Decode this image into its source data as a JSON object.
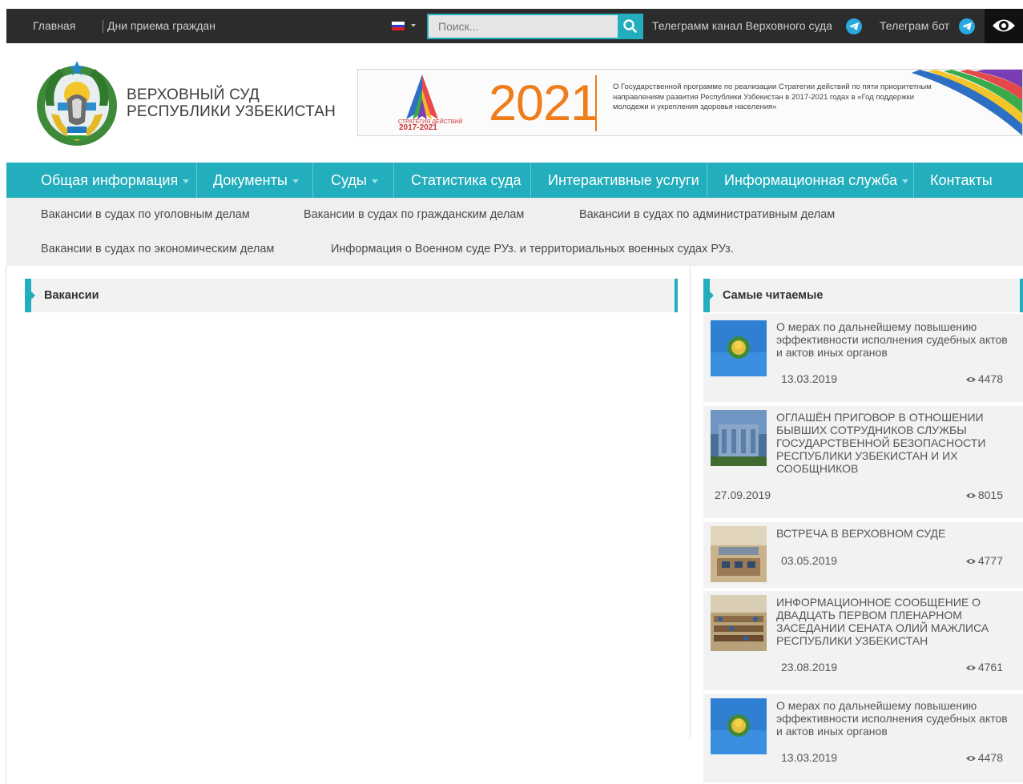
{
  "topbar": {
    "home_link": "Главная",
    "reception_link": "Дни приема граждан",
    "search_placeholder": "Поиск...",
    "telegram_channel": "Телеграмм канал Верховного суда",
    "telegram_bot": "Телеграм бот",
    "language_flag_icon": "russian-flag-icon",
    "accessibility_icon": "eye-icon"
  },
  "header": {
    "title_line1": "ВЕРХОВНЫЙ СУД",
    "title_line2": "РЕСПУБЛИКИ УЗБЕКИСТАН",
    "emblem_icon": "state-emblem-icon"
  },
  "banner": {
    "year": "2021",
    "years_range": "2017-2021",
    "strategy_label": "СТРАТЕГИЯ ДЕЙСТВИЙ",
    "text": "О Государственной программе по реализации Стратегии действий по пяти приоритетным направлениям развития Республики Узбекистан в 2017-2021 годах в «Год поддержки молодежи и укрепления здоровья населения»"
  },
  "nav": [
    {
      "label": "Общая информация"
    },
    {
      "label": "Документы"
    },
    {
      "label": "Суды"
    },
    {
      "label": "Статистика суда"
    },
    {
      "label": "Интерактивные услуги"
    },
    {
      "label": "Информационная служба"
    },
    {
      "label": "Контакты"
    }
  ],
  "submenu": [
    {
      "label": "Вакансии в судах по уголовным делам"
    },
    {
      "label": "Вакансии в судах по гражданским делам"
    },
    {
      "label": "Вакансии в судах по административным делам"
    },
    {
      "label": "Вакансии в судах по экономическим делам"
    },
    {
      "label": "Информация о Военном суде РУз. и территориальных военных судах РУз."
    }
  ],
  "main": {
    "section_title": "Вакансии"
  },
  "sidebar": {
    "title": "Самые читаемые",
    "items": [
      {
        "title": "О мерах по дальнейшему повышению эффективности исполнения судебных актов и актов иных органов",
        "date": "13.03.2019",
        "views": "4478"
      },
      {
        "title": "ОГЛАШЁН ПРИГОВОР В ОТНОШЕНИИ БЫВШИХ СОТРУДНИКОВ СЛУЖБЫ ГОСУДАРСТВЕННОЙ БЕЗОПАСНОСТИ РЕСПУБЛИКИ УЗБЕКИСТАН И ИХ СООБЩНИКОВ",
        "date": "27.09.2019",
        "views": "8015"
      },
      {
        "title": "ВСТРЕЧА В ВЕРХОВНОМ СУДЕ",
        "date": "03.05.2019",
        "views": "4777"
      },
      {
        "title": "ИНФОРМАЦИОННОЕ СООБЩЕНИЕ О ДВАДЦАТЬ ПЕРВОМ ПЛЕНАРНОМ ЗАСЕДАНИИ СЕНАТА ОЛИЙ МАЖЛИСА РЕСПУБЛИКИ УЗБЕКИСТАН",
        "date": "23.08.2019",
        "views": "4761"
      },
      {
        "title": "О мерах по дальнейшему повышению эффективности исполнения судебных актов и актов иных органов",
        "date": "13.03.2019",
        "views": "4478"
      }
    ]
  },
  "colors": {
    "accent": "#23aebd",
    "topbar_bg": "#2c2c2c",
    "year_orange": "#ef7d1a"
  }
}
